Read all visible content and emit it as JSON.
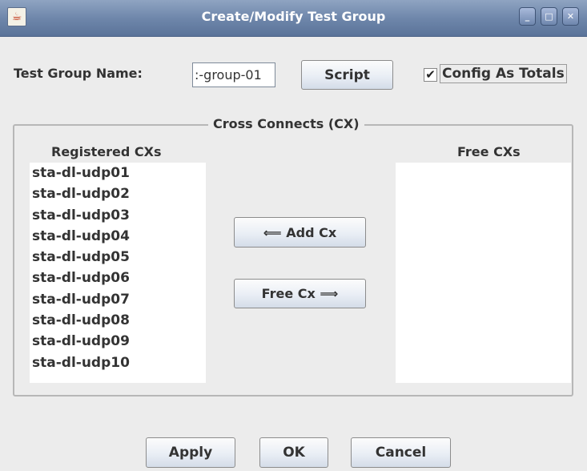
{
  "window": {
    "title": "Create/Modify Test Group",
    "app_icon": "java-icon"
  },
  "window_controls": {
    "minimize": "_",
    "maximize": "□",
    "close": "✕"
  },
  "header": {
    "name_label": "Test Group Name:",
    "name_value": ":-group-01",
    "script_label": "Script",
    "config_checked": true,
    "config_check_mark": "✔",
    "config_label": "Config As Totals"
  },
  "cross_connects": {
    "title": "Cross Connects (CX)",
    "registered_title": "Registered CXs",
    "free_title": "Free CXs",
    "registered": [
      "sta-dl-udp01",
      "sta-dl-udp02",
      "sta-dl-udp03",
      "sta-dl-udp04",
      "sta-dl-udp05",
      "sta-dl-udp06",
      "sta-dl-udp07",
      "sta-dl-udp08",
      "sta-dl-udp09",
      "sta-dl-udp10"
    ],
    "free": [],
    "add_label": "⟸ Add Cx",
    "free_label": "Free Cx ⟹"
  },
  "footer": {
    "apply_label": "Apply",
    "ok_label": "OK",
    "cancel_label": "Cancel"
  }
}
